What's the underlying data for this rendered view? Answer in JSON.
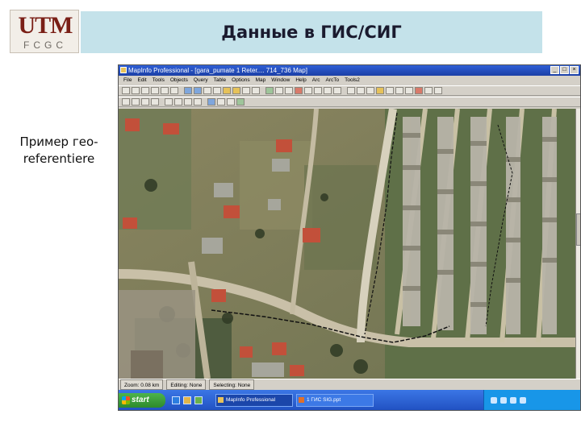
{
  "slide": {
    "logo_text": "UTM",
    "logo_subtitle": "FCGC",
    "title": "Данные в ГИС/СИГ",
    "side_note": "Пример гео-referentiere"
  },
  "app": {
    "window_title": "MapInfo Professional - [gara_pumate 1 Reter.... 714_736 Map]",
    "window_buttons": [
      "minimize-icon",
      "maximize-icon",
      "close-icon"
    ],
    "menu": [
      "File",
      "Edit",
      "Tools",
      "Objects",
      "Query",
      "Table",
      "Options",
      "Map",
      "Window",
      "Help",
      "Arc",
      "ArcTo",
      "Tools2"
    ],
    "status": {
      "zoom": "Zoom: 0.08 km",
      "editing": "Editing: None",
      "selecting": "Selecting: None"
    },
    "taskbar": {
      "start": "start",
      "tasks": [
        "MapInfo Professional",
        "1 ГИС SIG.ppt"
      ]
    }
  },
  "colors": {
    "title_band": "#c4e2ea",
    "logo_red": "#7a1f16",
    "taskbar_blue": "#1f4fc0",
    "start_green": "#2d8a2c"
  }
}
